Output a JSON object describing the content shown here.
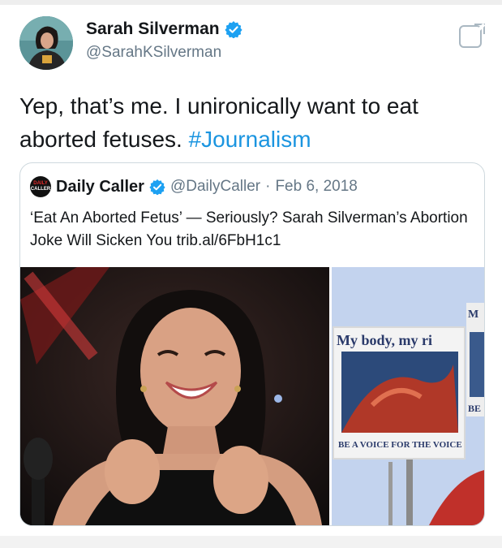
{
  "author": {
    "display_name": "Sarah Silverman",
    "handle": "@SarahKSilverman",
    "avatar_icon": "profile-photo",
    "verified_icon": "verified-badge-icon"
  },
  "tweet": {
    "text": "Yep, that’s me. I unironically want to eat aborted fetuses.",
    "hashtag": "#Journalism"
  },
  "quoted": {
    "logo_line1": "DAILY",
    "logo_line2": "CALLER",
    "display_name": "Daily Caller",
    "handle": "@DailyCaller",
    "separator": "·",
    "date": "Feb 6, 2018",
    "text": "‘Eat An Aborted Fetus’ — Seriously? Sarah Silverman’s Abortion Joke Will Sicken You trib.al/6FbH1c1"
  },
  "media": {
    "sign_line1": "My body, my ri",
    "sign_line2": "BE A VOICE FOR THE VOICE",
    "sign_side1": "M",
    "sign_side2": "BE"
  },
  "colors": {
    "accent": "#1b95e0",
    "verified": "#1da1f2",
    "secondary_text": "#657786"
  }
}
